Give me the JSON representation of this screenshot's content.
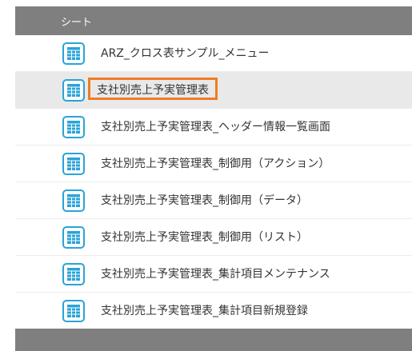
{
  "header": {
    "title": "シート"
  },
  "items": [
    {
      "label": "ARZ_クロス表サンプル_メニュー",
      "icon": "spreadsheet-icon"
    },
    {
      "label": "支社別売上予実管理表",
      "icon": "spreadsheet-icon",
      "selected": true
    },
    {
      "label": "支社別売上予実管理表_ヘッダー情報一覧画面",
      "icon": "spreadsheet-icon"
    },
    {
      "label": "支社別売上予実管理表_制御用（アクション）",
      "icon": "spreadsheet-icon"
    },
    {
      "label": "支社別売上予実管理表_制御用（データ）",
      "icon": "spreadsheet-icon"
    },
    {
      "label": "支社別売上予実管理表_制御用（リスト）",
      "icon": "spreadsheet-icon"
    },
    {
      "label": "支社別売上予実管理表_集計項目メンテナンス",
      "icon": "spreadsheet-icon"
    },
    {
      "label": "支社別売上予実管理表_集計項目新規登録",
      "icon": "spreadsheet-icon"
    }
  ],
  "colors": {
    "header_bg": "#7f7f7f",
    "selected_bg": "#e9e9e9",
    "highlight_border": "#ee7d25",
    "icon_accent": "#2aa3d8"
  }
}
